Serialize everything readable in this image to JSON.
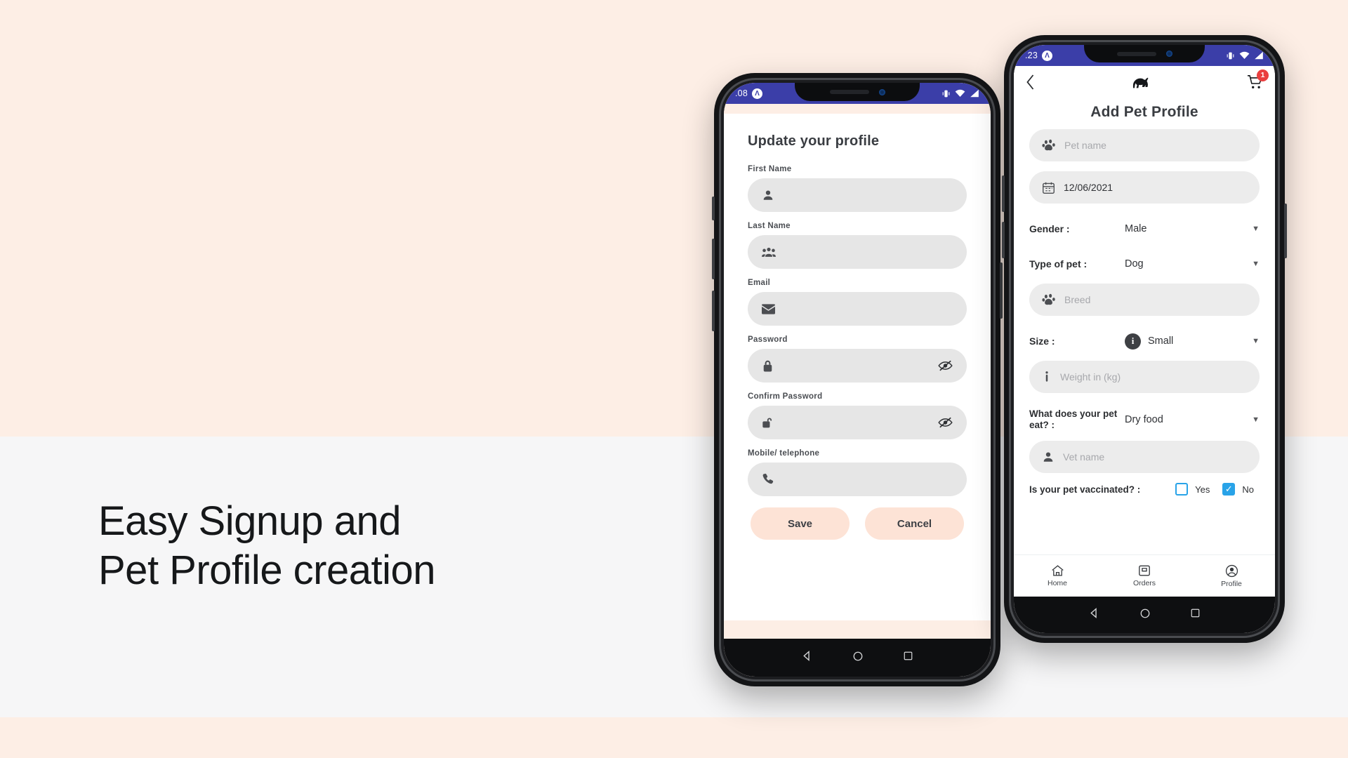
{
  "page": {
    "headline_line1": "Easy Signup and",
    "headline_line2": "Pet Profile creation",
    "band_top_color": "#fdeee5",
    "band_mid_color": "#f6f6f7",
    "accent_blue": "#3b3ea8",
    "accent_pink": "#fde3d6",
    "checkbox_blue": "#29a3e8",
    "badge_red": "#ea3f3f"
  },
  "left_phone": {
    "status": {
      "time": ".08",
      "badge_glyph": "Λ"
    },
    "title": "Update your profile",
    "fields": [
      {
        "label": "First Name",
        "icon": "user-icon",
        "value": "",
        "has_eye": false
      },
      {
        "label": "Last Name",
        "icon": "users-group-icon",
        "value": "",
        "has_eye": false
      },
      {
        "label": "Email",
        "icon": "envelope-icon",
        "value": "",
        "has_eye": false
      },
      {
        "label": "Password",
        "icon": "lock-closed-icon",
        "value": "",
        "has_eye": true
      },
      {
        "label": "Confirm Password",
        "icon": "lock-open-icon",
        "value": "",
        "has_eye": true
      },
      {
        "label": "Mobile/ telephone",
        "icon": "phone-icon",
        "value": "",
        "has_eye": false
      }
    ],
    "save_label": "Save",
    "cancel_label": "Cancel"
  },
  "right_phone": {
    "status": {
      "time": ".23",
      "badge_glyph": "Λ"
    },
    "appbar": {
      "back_icon": "chevron-left-icon",
      "logo_icon": "dog-logo-icon",
      "cart_icon": "shopping-cart-icon",
      "cart_badge": "1"
    },
    "title": "Add Pet Profile",
    "fields": {
      "pet_name_placeholder": "Pet name",
      "pet_name_icon": "paw-icon",
      "dob_value": "12/06/2021",
      "dob_icon": "calendar-icon",
      "breed_placeholder": "Breed",
      "breed_icon": "paw-icon",
      "weight_placeholder": "Weight in (kg)",
      "weight_icon": "info-thin-icon",
      "vet_placeholder": "Vet name",
      "vet_icon": "user-icon"
    },
    "selects": [
      {
        "label": "Gender :",
        "value": "Male",
        "icon": null
      },
      {
        "label": "Type of pet :",
        "value": "Dog",
        "icon": null
      },
      {
        "label": "Size :",
        "value": "Small",
        "icon": "info-circle-icon"
      },
      {
        "label": "What does your pet eat? :",
        "value": "Dry food",
        "icon": null
      }
    ],
    "vaccination": {
      "label": "Is your pet vaccinated? :",
      "yes_label": "Yes",
      "yes_checked": false,
      "no_label": "No",
      "no_checked": true
    },
    "tabs": [
      {
        "label": "Home",
        "icon": "home-icon"
      },
      {
        "label": "Orders",
        "icon": "orders-box-icon"
      },
      {
        "label": "Profile",
        "icon": "profile-circle-icon"
      }
    ]
  }
}
